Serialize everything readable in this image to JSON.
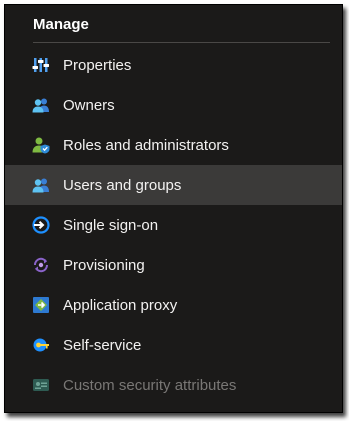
{
  "section": {
    "title": "Manage"
  },
  "items": [
    {
      "label": "Properties",
      "icon": "properties-icon"
    },
    {
      "label": "Owners",
      "icon": "owners-icon"
    },
    {
      "label": "Roles and administrators",
      "icon": "roles-administrators-icon"
    },
    {
      "label": "Users and groups",
      "icon": "users-groups-icon",
      "selected": true
    },
    {
      "label": "Single sign-on",
      "icon": "single-sign-on-icon"
    },
    {
      "label": "Provisioning",
      "icon": "provisioning-icon"
    },
    {
      "label": "Application proxy",
      "icon": "application-proxy-icon"
    },
    {
      "label": "Self-service",
      "icon": "self-service-icon"
    },
    {
      "label": "Custom security attributes",
      "icon": "custom-security-attributes-icon",
      "disabled": true
    }
  ],
  "colors": {
    "panel_bg": "#1b1a19",
    "selected_bg": "#3b3a39",
    "text": "#f3f2f1",
    "disabled_text": "#797775",
    "accent_blue": "#0078d4"
  }
}
